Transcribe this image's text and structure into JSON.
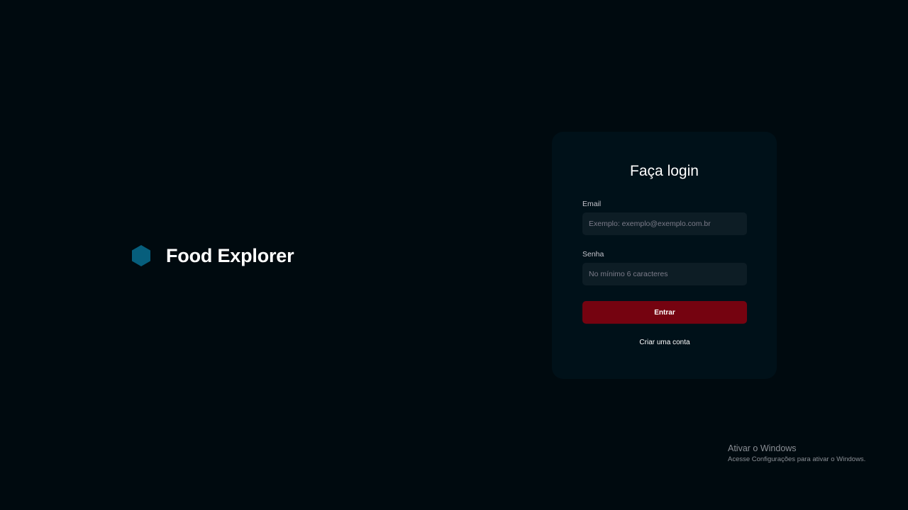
{
  "brand": {
    "name": "Food Explorer",
    "logo_icon": "hexagon-icon",
    "logo_color": "#065e7c"
  },
  "login": {
    "title": "Faça login",
    "email": {
      "label": "Email",
      "value": "",
      "placeholder": "Exemplo: exemplo@exemplo.com.br"
    },
    "password": {
      "label": "Senha",
      "value": "",
      "placeholder": "No mínimo 6 caracteres"
    },
    "submit_label": "Entrar",
    "signup_label": "Criar uma conta"
  },
  "windows_watermark": {
    "title": "Ativar o Windows",
    "subtitle": "Acesse Configurações para ativar o Windows."
  },
  "colors": {
    "background": "#000a0f",
    "card": "#001119",
    "input": "#0d1d25",
    "button": "#750310"
  }
}
